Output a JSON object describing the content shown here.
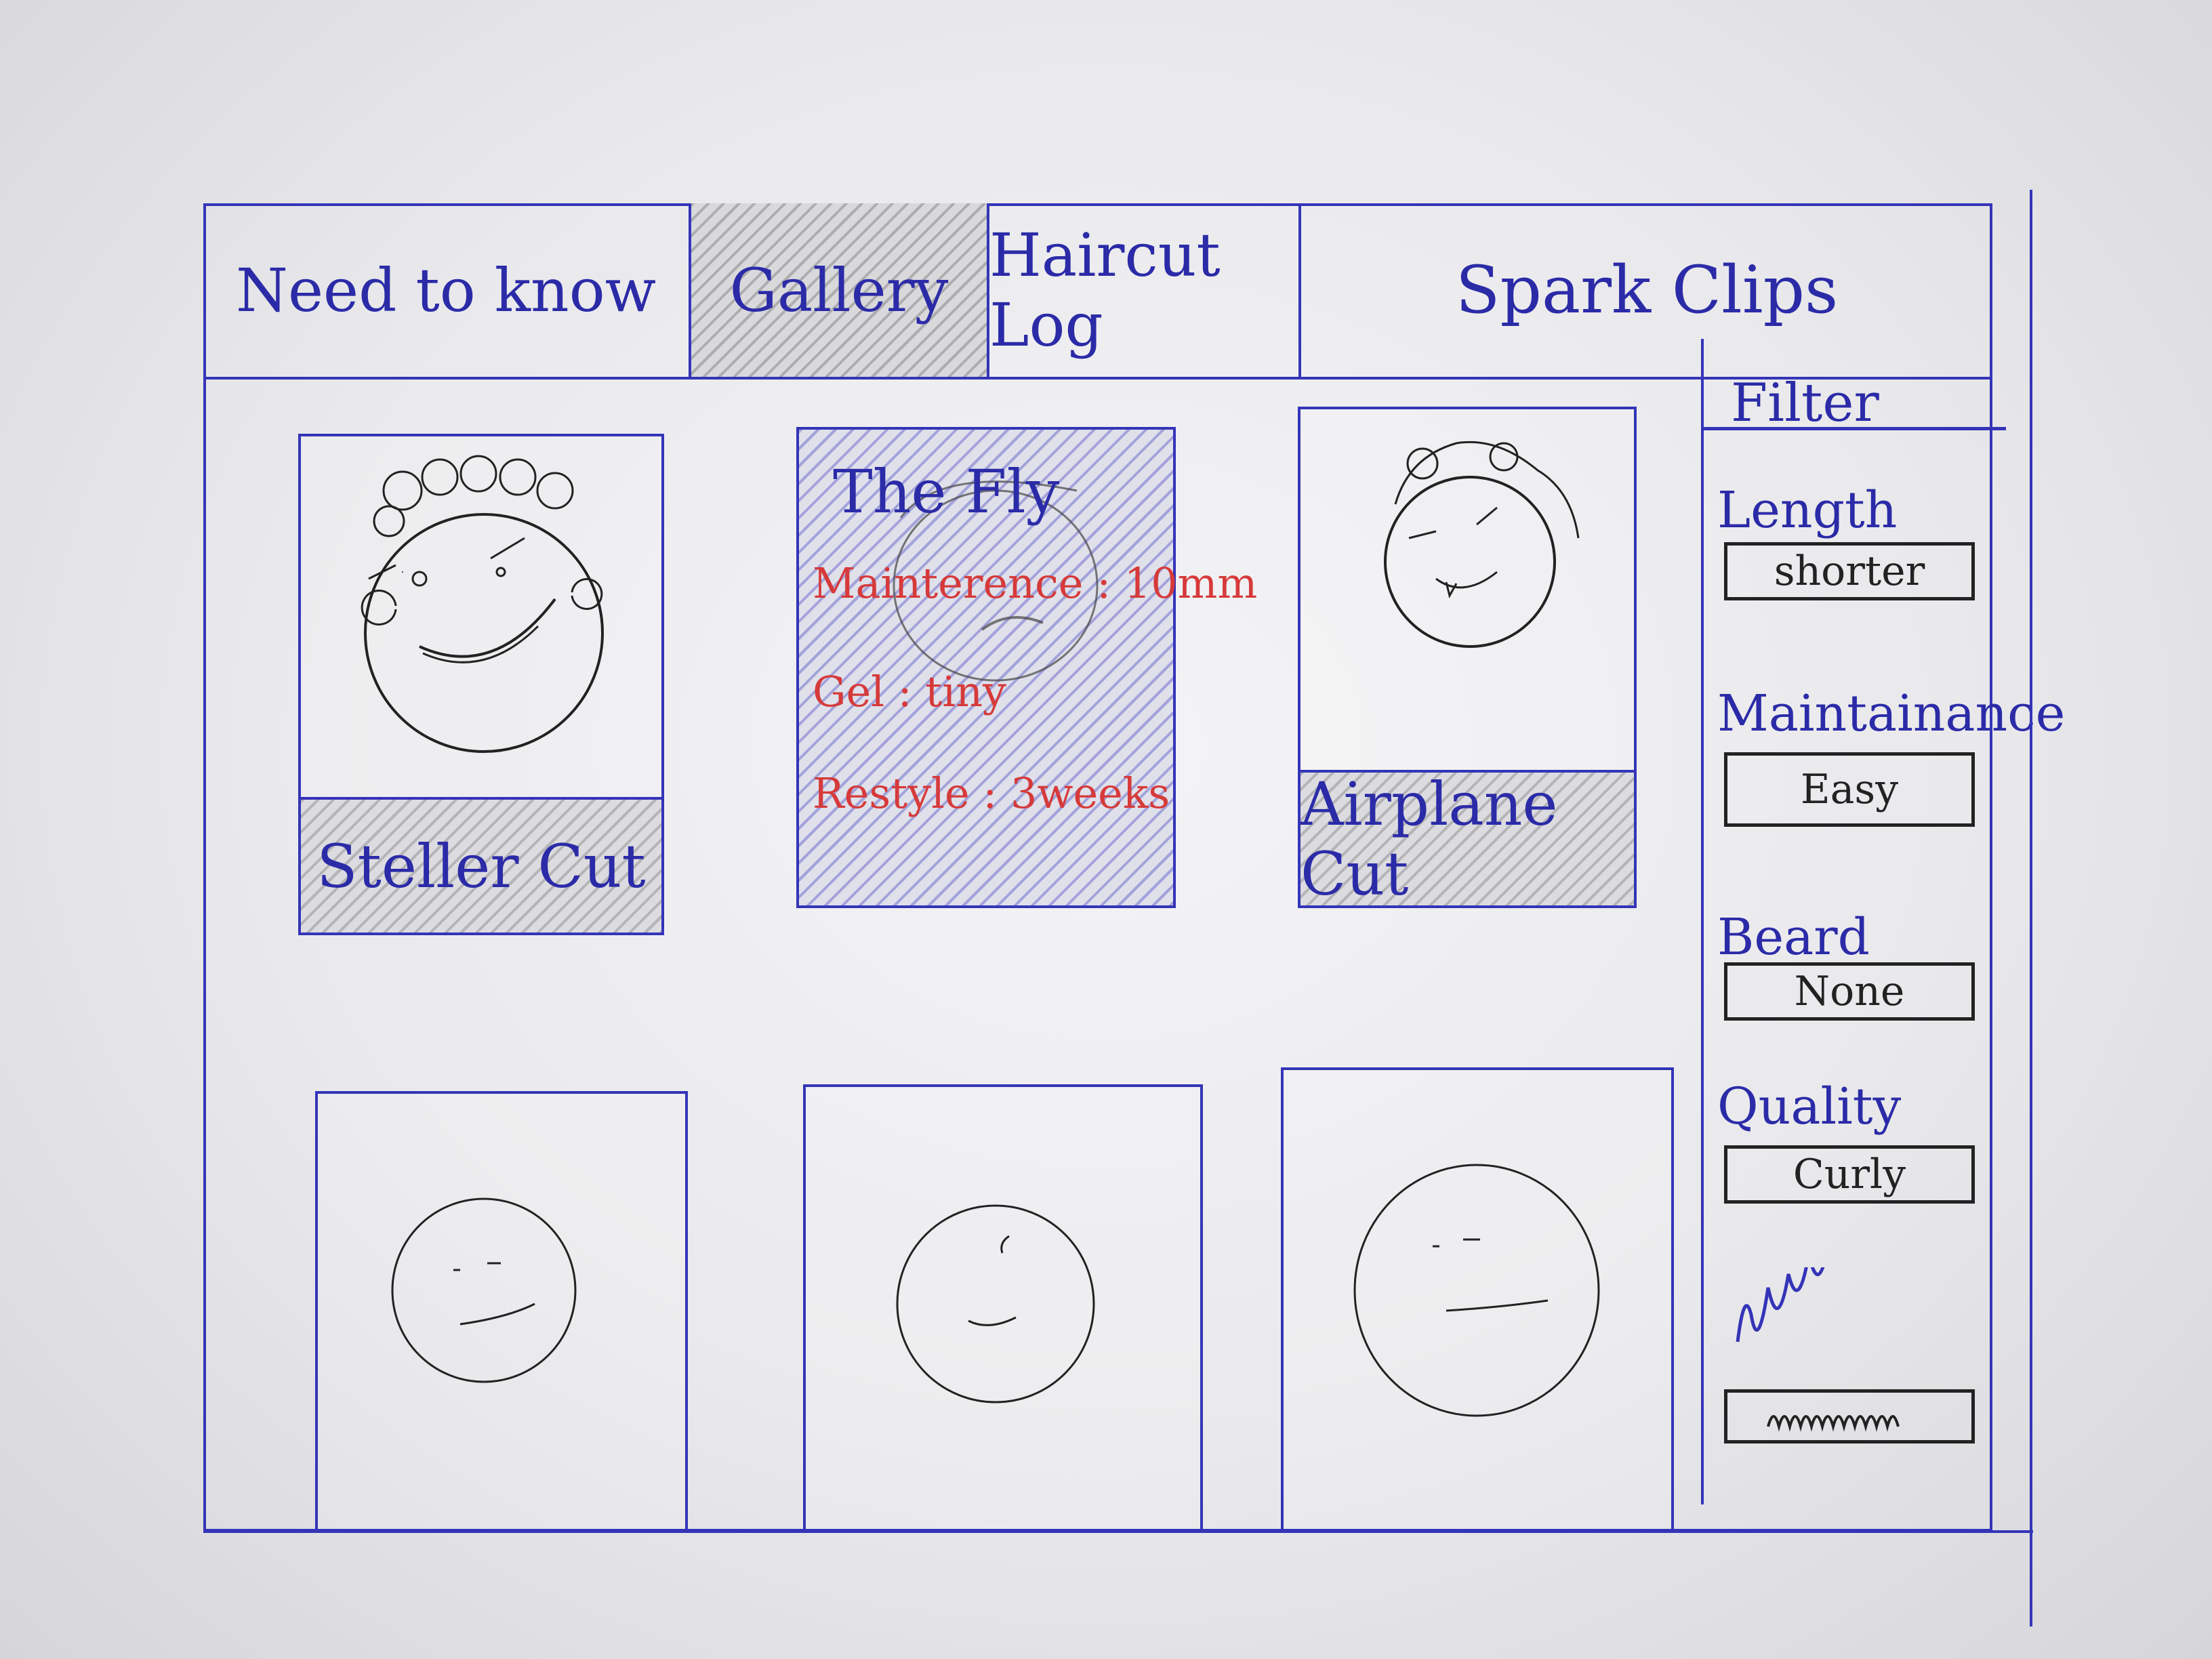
{
  "nav": {
    "tabs": [
      {
        "label": "Need to know"
      },
      {
        "label": "Gallery"
      },
      {
        "label": "Haircut Log"
      }
    ],
    "brand": "Spark Clips"
  },
  "gallery": {
    "cards": [
      {
        "caption": "Steller Cut"
      },
      {
        "hover_title": "The Fly",
        "details": [
          "Mainterence : 10mm",
          "Gel : tiny",
          "Restyle : 3weeks"
        ]
      },
      {
        "caption": "Airplane Cut"
      }
    ]
  },
  "filter": {
    "header": "Filter",
    "groups": [
      {
        "label": "Length",
        "value": "shorter"
      },
      {
        "label": "Maintainance",
        "value": "Easy"
      },
      {
        "label": "Beard",
        "value": "None"
      },
      {
        "label": "Quality",
        "value": "Curly"
      }
    ]
  },
  "colors": {
    "ink_blue": "#3434b8",
    "ink_red": "#d63a3a",
    "ink_black": "#222222"
  }
}
